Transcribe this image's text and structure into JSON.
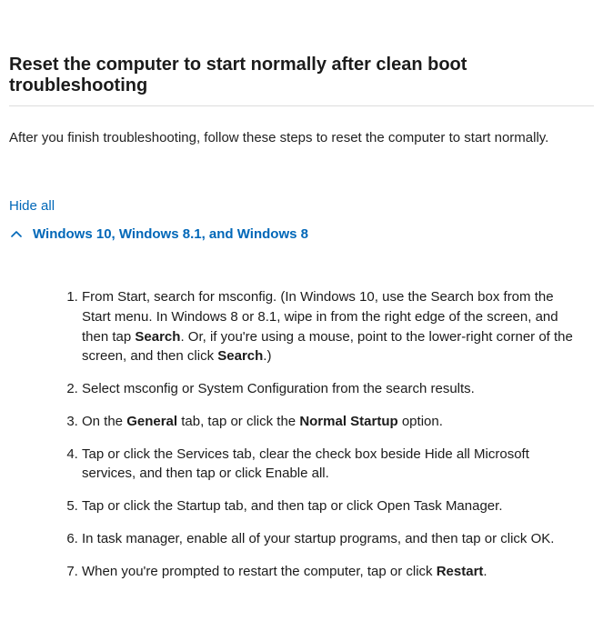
{
  "heading": "Reset the computer to start normally after clean boot troubleshooting",
  "intro": "After you finish troubleshooting, follow these steps to reset the computer to start normally.",
  "hide_all": "Hide all",
  "accordion": {
    "title": "Windows 10, Windows 8.1, and Windows 8"
  },
  "steps": {
    "s1": {
      "t1": "From Start, search for msconfig. (In Windows 10, use the Search box from the Start menu. In Windows 8 or 8.1, wipe in from the right edge of the screen, and then tap ",
      "b1": "Search",
      "t2": ". Or, if you're using a mouse, point to the lower-right corner of the screen, and then click ",
      "b2": "Search",
      "t3": ".)"
    },
    "s2": {
      "t1": "Select msconfig or System Configuration from the search results."
    },
    "s3": {
      "t1": "On the ",
      "b1": "General",
      "t2": " tab, tap or click the ",
      "b2": "Normal Startup",
      "t3": " option."
    },
    "s4": {
      "t1": "Tap or click the Services tab, clear the check box beside Hide all Microsoft services, and then tap or click Enable all."
    },
    "s5": {
      "t1": "Tap or click the Startup tab, and then tap or click Open Task Manager."
    },
    "s6": {
      "t1": "In task manager, enable all of your startup programs, and then tap or click OK."
    },
    "s7": {
      "t1": "When you're prompted to restart the computer, tap or click ",
      "b1": "Restart",
      "t2": "."
    }
  }
}
